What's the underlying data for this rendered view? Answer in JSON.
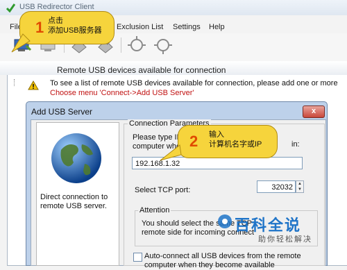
{
  "app": {
    "title": "USB Redirector Client"
  },
  "menu": {
    "items": [
      "File",
      "Exclusion List",
      "Settings",
      "Help"
    ]
  },
  "toolbar": {
    "icons": [
      "connect-icon",
      "disconnect-icon",
      "add-device-icon",
      "remove-device-icon",
      "autoconnect-icon",
      "refresh-icon"
    ]
  },
  "panel": {
    "header": "Remote USB devices available for connection",
    "info_text": "To see a list of remote USB devices available for connection, please add one or more",
    "info_link": "Choose menu 'Connect->Add USB Server'"
  },
  "dialog": {
    "title": "Add USB Server",
    "close_label": "x",
    "left_caption": "Direct connection to remote USB server.",
    "group_label": "Connection Parameters",
    "prompt_line1": "Please type IP",
    "prompt_line2": "computer whe",
    "prompt_tail": "in:",
    "ip_value": "192.168.1.32",
    "port_label": "Select TCP port:",
    "port_value": "32032",
    "attention_label": "Attention",
    "attention_line1": "You should select the same TCP",
    "attention_line2": "remote side for incoming connect",
    "autoconnect_line1": "Auto-connect all USB devices from the remote",
    "autoconnect_line2": "computer when they become available"
  },
  "callouts": [
    {
      "number": "1",
      "line1": "点击",
      "line2": "添加USB服务器"
    },
    {
      "number": "2",
      "line1": "输入",
      "line2": "计算机名字或IP"
    }
  ],
  "watermark": {
    "title": "百科全说",
    "subtitle": "助你轻松解决"
  },
  "colors": {
    "link_red": "#c01010",
    "callout_yellow": "#f6d43c",
    "brand_blue": "#1f74c8"
  }
}
